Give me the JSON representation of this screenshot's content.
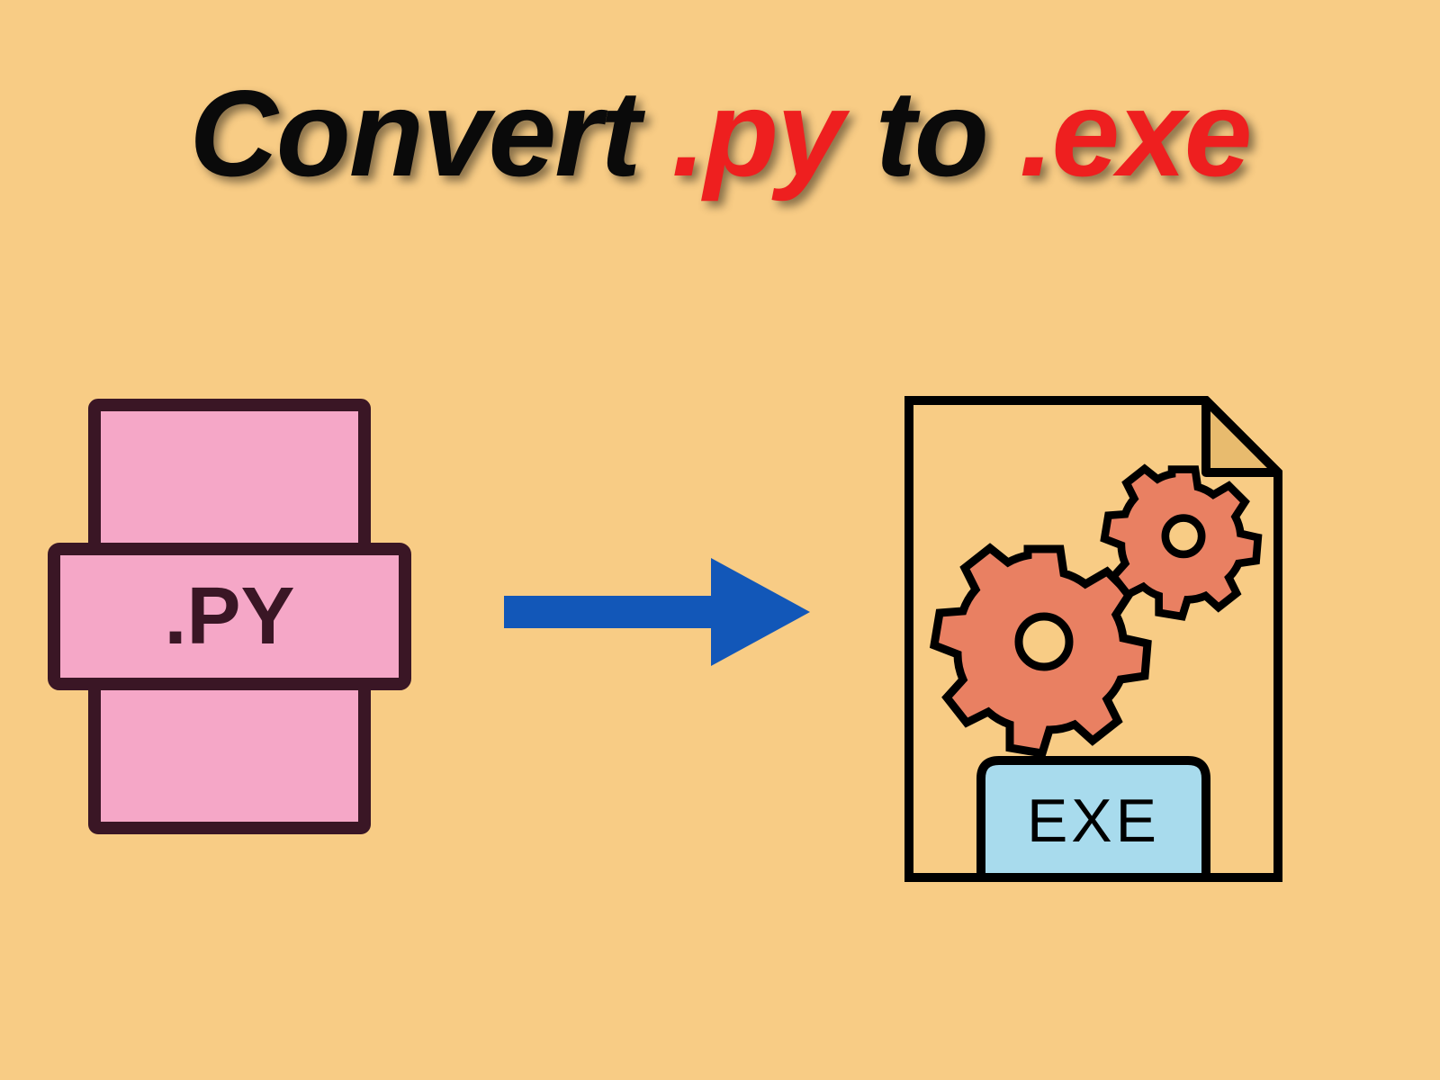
{
  "title": {
    "word1": "Convert",
    "word2": ".py",
    "word3": "to",
    "word4": ".exe"
  },
  "py_label": ".PY",
  "exe_label": "EXE",
  "colors": {
    "bg": "#f8cc85",
    "dark": "#0a0a0a",
    "red": "#ee1f1f",
    "py_fill": "#f5a7c7",
    "py_stroke": "#3a1625",
    "arrow": "#1257b8",
    "exe_stroke": "#000000",
    "exe_tab": "#a8dbed",
    "exe_fold": "#e8bb6e",
    "gear": "#e98062",
    "gear_stroke": "#000000"
  }
}
